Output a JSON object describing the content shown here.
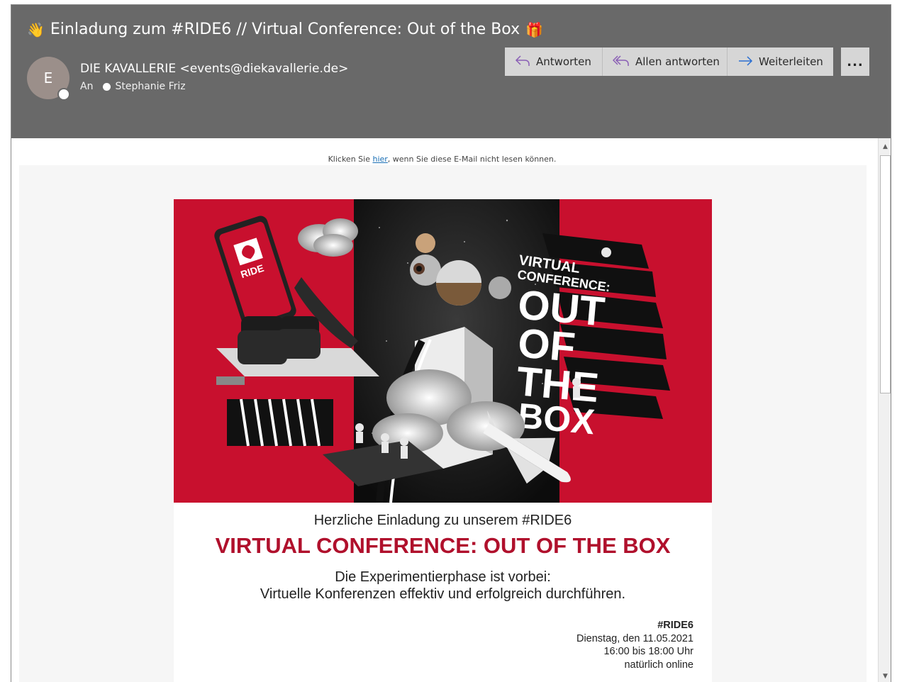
{
  "message": {
    "subject": "Einladung zum #RIDE6 // Virtual Conference: Out of the Box",
    "subject_prefix_icon": "waving-hand-icon",
    "subject_suffix_icon": "gift-icon",
    "avatar_initial": "E",
    "sender": "DIE KAVALLERIE <events@diekavallerie.de>",
    "to_label": "An",
    "to_recipient": "Stephanie Friz"
  },
  "toolbar": {
    "reply": "Antworten",
    "reply_all": "Allen antworten",
    "forward": "Weiterleiten",
    "more": "..."
  },
  "email": {
    "cant_read_prefix": "Klicken Sie ",
    "cant_read_link": "hier",
    "cant_read_suffix": ", wenn Sie diese E-Mail nicht lesen können.",
    "banner": {
      "ride_sign": "RIDE",
      "title_lines": [
        "VIRTUAL",
        "CONFERENCE:",
        "OUT",
        "OF",
        "THE",
        "BOX"
      ]
    },
    "intro": "Herzliche Einladung zu unserem #RIDE6",
    "headline": "VIRTUAL CONFERENCE: OUT OF THE BOX",
    "sub1": "Die Experimentierphase ist vorbei:",
    "sub2": "Virtuelle Konferenzen effektiv und erfolgreich durchführen.",
    "details": {
      "tag": "#RIDE6",
      "date": "Dienstag, den 11.05.2021",
      "time": "16:00 bis 18:00 Uhr",
      "location": "natürlich online"
    }
  },
  "colors": {
    "header_bg": "#696969",
    "banner_red": "#c8102e",
    "headline_red": "#b0102c",
    "link_blue": "#1a6fb5"
  }
}
